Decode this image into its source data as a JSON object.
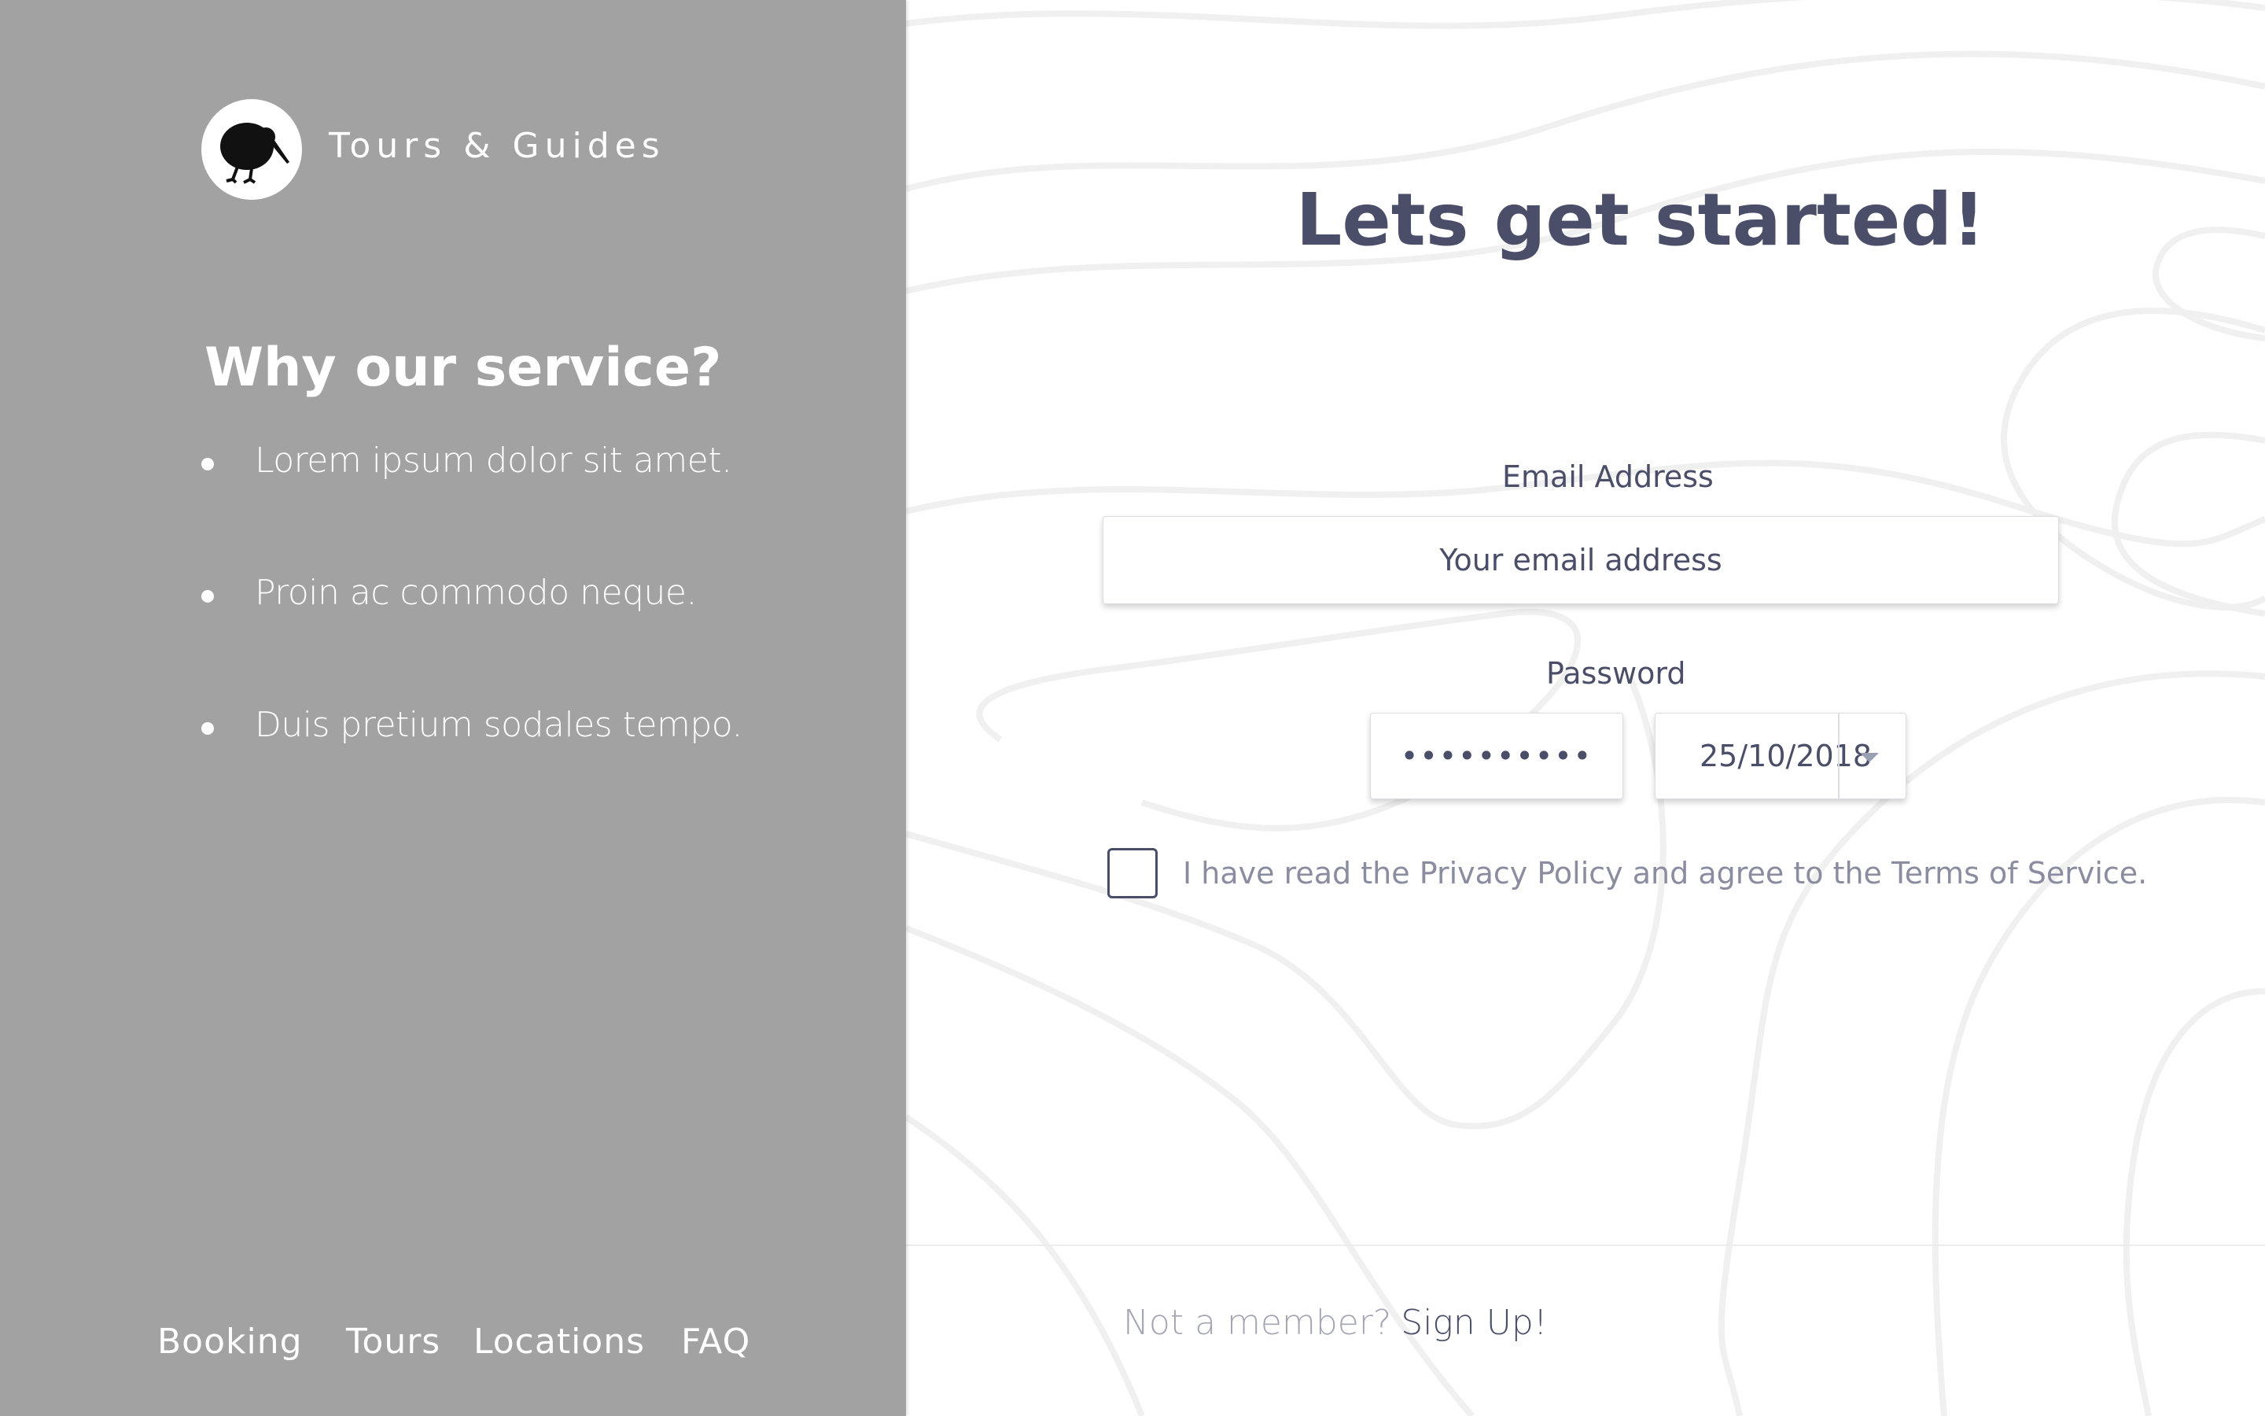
{
  "brand": {
    "name": "Tours & Guides",
    "logo_icon": "kiwi-bird-icon"
  },
  "sidebar": {
    "title": "Why our service?",
    "bullets": [
      "Lorem ipsum dolor sit amet.",
      "Proin ac commodo neque.",
      "Duis pretium sodales tempo."
    ]
  },
  "footer_nav": {
    "items": [
      "Booking",
      "Tours",
      "Locations",
      "FAQ"
    ]
  },
  "form": {
    "heading": "Lets get started!",
    "email_label": "Email Address",
    "email_placeholder": "Your email address",
    "password_label": "Password",
    "password_value": "••••••••••",
    "date_value": "25/10/2018",
    "terms_checked": false,
    "terms_text": "I have read the Privacy Policy and agree to the Terms of Service."
  },
  "signup": {
    "prompt": "Not a member?",
    "link": "Sign Up!"
  },
  "colors": {
    "sidebar_bg": "#a2a2a2",
    "heading": "#4a4e69",
    "muted_text": "#8a8ca0",
    "topo_lines": "#f0f0f0"
  }
}
